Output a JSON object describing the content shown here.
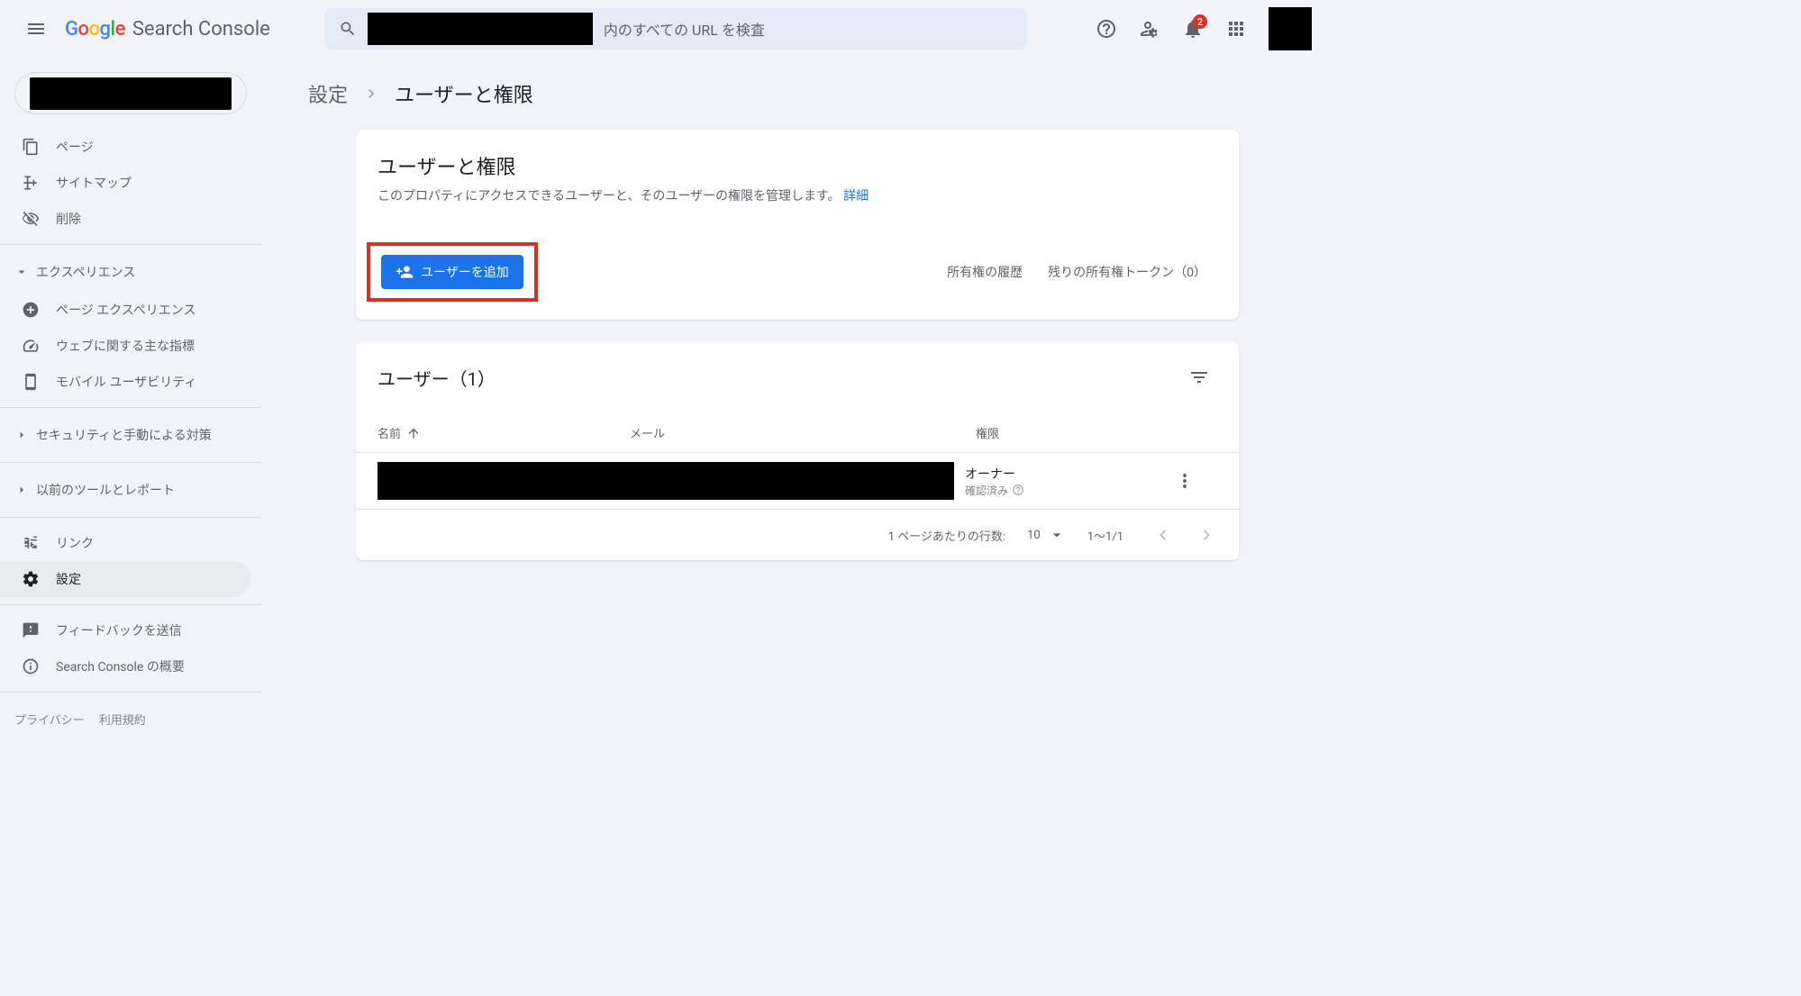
{
  "header": {
    "app_name": "Search Console",
    "search_placeholder_suffix": "内のすべての URL を検査",
    "notification_count": "2"
  },
  "sidebar": {
    "items": {
      "pages": "ページ",
      "sitemaps": "サイトマップ",
      "removals": "削除",
      "experience_header": "エクスペリエンス",
      "page_experience": "ページ エクスペリエンス",
      "web_vitals": "ウェブに関する主な指標",
      "mobile_usability": "モバイル ユーザビリティ",
      "security_header": "セキュリティと手動による対策",
      "legacy_header": "以前のツールとレポート",
      "links": "リンク",
      "settings": "設定",
      "feedback": "フィードバックを送信",
      "about": "Search Console の概要"
    },
    "footer": {
      "privacy": "プライバシー",
      "terms": "利用規約"
    }
  },
  "breadcrumb": {
    "parent": "設定",
    "current": "ユーザーと権限"
  },
  "users_card": {
    "title": "ユーザーと権限",
    "desc_prefix": "このプロパティにアクセスできるユーザーと、そのユーザーの権限を管理します。",
    "desc_link": "詳細",
    "add_button": "ユーザーを追加",
    "ownership_history": "所有権の履歴",
    "token_text": "残りの所有権トークン（0）"
  },
  "table": {
    "title": "ユーザー（1）",
    "col_name": "名前",
    "col_mail": "メール",
    "col_perm": "権限",
    "row_perm_title": "オーナー",
    "row_perm_sub": "確認済み",
    "pager_rows_label": "1 ページあたりの行数:",
    "pager_rows_value": "10",
    "pager_range": "1～1/1"
  }
}
